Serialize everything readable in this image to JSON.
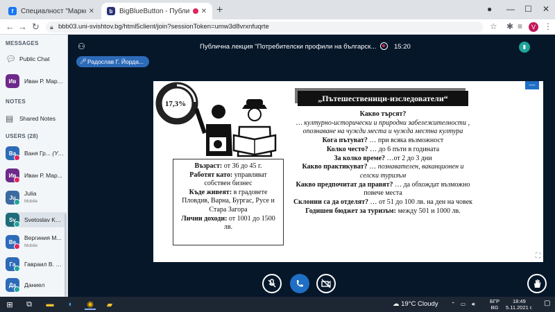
{
  "browser": {
    "tabs": [
      {
        "title": "Специалност \"Маркетинг\" вигуо",
        "favicon": "facebook-icon",
        "color": "#1877f2"
      },
      {
        "title": "BigBlueButton - Публична л",
        "favicon": "bigbluebutton-icon",
        "color": "#283274"
      }
    ],
    "url": "bbb03.uni-svishtov.bg/html5client/join?sessionToken=umw3d8vrxnfuqrte",
    "profile_initial": "V"
  },
  "sidebar": {
    "messages_title": "MESSAGES",
    "public_chat": "Public Chat",
    "private_chat": {
      "initials": "Ив",
      "name": "Иван Р. Марч..."
    },
    "notes_title": "NOTES",
    "shared_notes": "Shared Notes",
    "users_title": "USERS (28)",
    "users": [
      {
        "initials": "Ва",
        "name": "Ваня Гр...",
        "sub": "(You)",
        "color": "#2d6bb9",
        "status": "#e0245e"
      },
      {
        "initials": "Ив",
        "name": "Иван Р. Мар...",
        "sub": "",
        "color": "#6d2a8a",
        "status": "#e0245e"
      },
      {
        "initials": "Ju",
        "name": "Julia",
        "sub": "Mobile",
        "color": "#3b6aa0",
        "status": "#1fa39a"
      },
      {
        "initials": "Sv",
        "name": "Svetoslav Kal...",
        "sub": "",
        "color": "#1e6b7a",
        "status": "#1fa39a"
      },
      {
        "initials": "Ве",
        "name": "Вергиния М...",
        "sub": "Mobile",
        "color": "#2d6bb9",
        "status": "#e0245e"
      },
      {
        "initials": "Га",
        "name": "Гавраил В. В...",
        "sub": "",
        "color": "#2d6bb9",
        "status": "#1fa39a"
      },
      {
        "initials": "Да",
        "name": "Даниел",
        "sub": "",
        "color": "#2d6bb9",
        "status": "#1fa39a"
      }
    ]
  },
  "meeting": {
    "title": "Публична лекция \"Потребителски профили на българск...",
    "record_time": "15:20",
    "presenter": "Радослав Г. Йорда..."
  },
  "slide": {
    "percent": "17,3%",
    "heading": "„Пътешественици-изследователи“",
    "info": [
      {
        "label": "Възраст:",
        "value": " от 36 до 45 г."
      },
      {
        "label": "Работят като:",
        "value": " управляват собствен бизнес"
      },
      {
        "label": "Къде живеят:",
        "value": " в градовете Пловдив, Варна, Бургас, Русе и Стара Загора"
      },
      {
        "label": "Лични доходи:",
        "value": " от 1001 до 1500 лв."
      }
    ],
    "lines": [
      {
        "b": "Какво търсят?",
        "t": "",
        "i": ""
      },
      {
        "b": "",
        "t": "",
        "i": "… културно-исторически и природни забележителности , опознаване на чужди места и чужда местна култура"
      },
      {
        "b": "Кога пътуват?",
        "t": " … при всяка възможност",
        "i": ""
      },
      {
        "b": "Колко често?",
        "t": " … до 6 пъти в годината",
        "i": ""
      },
      {
        "b": "За колко време?",
        "t": " …от 2 до 3 дни",
        "i": ""
      },
      {
        "b": "Какво практикуват?",
        "t": " … ",
        "i": "познавателен, ваканционен и селски туризъм"
      },
      {
        "b": "Какво предпочитат да правят?",
        "t": " … да обхождат възможно повече места",
        "i": ""
      },
      {
        "b": "Склонни са да отделят?",
        "t": " … от 51 до 100 лв. на ден на човек",
        "i": ""
      },
      {
        "b": "Годишен бюджет за туризъм:",
        "t": " между 501 и 1000 лв.",
        "i": ""
      }
    ]
  },
  "taskbar": {
    "temperature": "19°C",
    "weather": "Cloudy",
    "lang_top": "БГР",
    "lang_bottom": "BG",
    "time": "18:49",
    "date": "5.11.2021 г."
  }
}
